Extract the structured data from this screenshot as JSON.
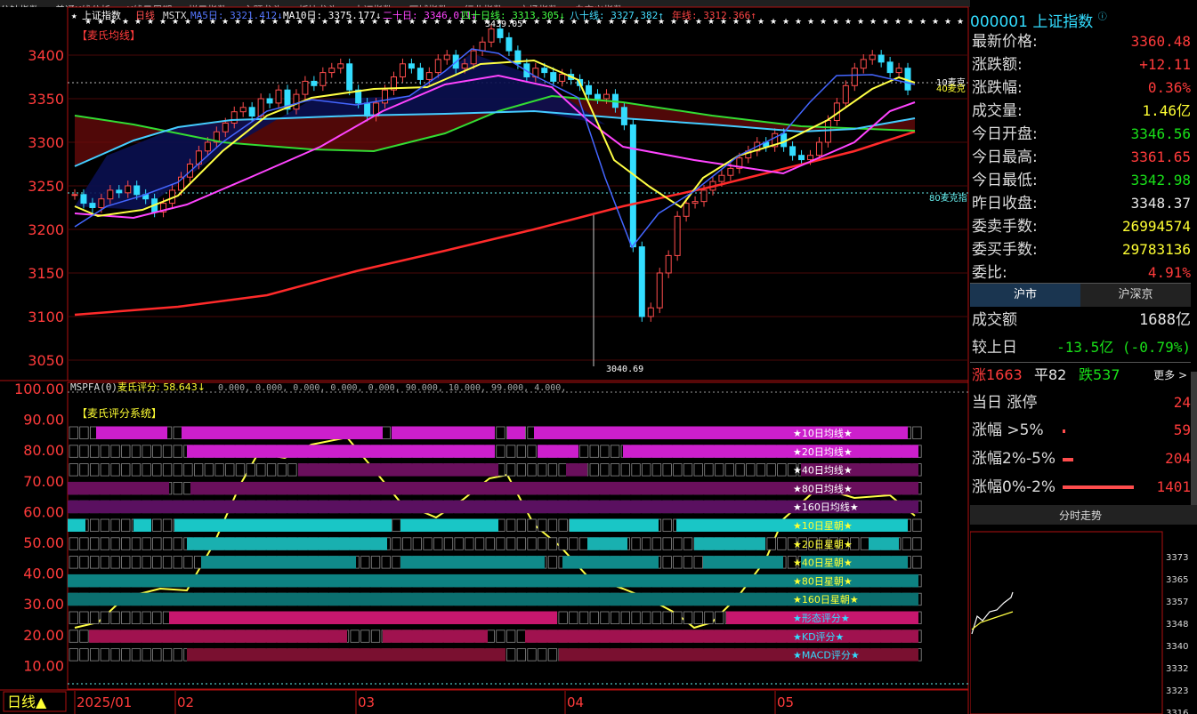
{
  "topbar": {
    "items": [
      "分钟指数",
      "普通K线分析",
      "K线日周期",
      "栏目指数",
      "主题龙头",
      "板块龙头",
      "中证指数",
      "区域指数",
      "行业指数",
      "市场指数",
      "自定义指数"
    ]
  },
  "main_legend": {
    "star": "★",
    "index_name": "上证指数",
    "period": "日线",
    "indicator_name": "MSTX",
    "ma5": "MA5日: 3321.412↓",
    "ma10": "MA10日: 3375.177↓",
    "ma20": "二十日: 3346.011↓",
    "ma40": "四十日线: 3313.305↓",
    "ma80": "八十线: 3327.382↑",
    "ma_long": "年线: 3312.366↑"
  },
  "labels": {
    "main_title": "【麦氏均线】",
    "high_marker": "3439.05",
    "low_marker": "3040.69",
    "right_10": "10麦克",
    "right_40": "40麦克",
    "right_80": "80麦克指",
    "sub_legend": "MSPFA(0)",
    "score_label": "麦氏评分: 58.643↓",
    "score_params": "0.000,  0.000,  0.000,  0.000,  0.000,  90.000,  10.000,  99.000,  4.000,",
    "score_title": "【麦氏评分系统】",
    "period_button": "日线▲",
    "date_labels": [
      "2025/01",
      "02",
      "03",
      "04",
      "05"
    ]
  },
  "price_axis": {
    "ticks": [
      3400,
      3350,
      3300,
      3250,
      3200,
      3150,
      3100,
      3050
    ]
  },
  "score_axis": {
    "ticks": [
      "100.00",
      "90.00",
      "80.00",
      "70.00",
      "60.00",
      "50.00",
      "40.00",
      "30.00",
      "20.00",
      "10.00"
    ]
  },
  "score_rows": [
    {
      "label": "★10日均线★"
    },
    {
      "label": "★20日均线★"
    },
    {
      "label": "★40日均线★"
    },
    {
      "label": "★80日均线★"
    },
    {
      "label": "★160日均线★"
    },
    {
      "label": "★10日星朝★"
    },
    {
      "label": "★20日星朝★"
    },
    {
      "label": "★40日星朝★"
    },
    {
      "label": "★80日星朝★"
    },
    {
      "label": "★160日星朝★"
    },
    {
      "label": "★形态评分★"
    },
    {
      "label": "★KD评分★"
    },
    {
      "label": "★MACD评分★"
    }
  ],
  "colors": {
    "magenta": "#cc1fcc",
    "dark_purple": "#6a0f5c",
    "cyan": "#19c6c6",
    "dark_teal": "#0d8282",
    "pink": "#c8176e",
    "maroon": "#7a1030",
    "up_red": "#ff3b3b",
    "down_cyan": "#33ddff"
  },
  "side": {
    "code": "000001",
    "name": "上证指数",
    "rows": [
      {
        "k": "最新价格:",
        "v": "3360.48",
        "c": "red"
      },
      {
        "k": "涨跌额:",
        "v": "+12.11",
        "c": "red"
      },
      {
        "k": "涨跌幅:",
        "v": "0.36%",
        "c": "red"
      },
      {
        "k": "成交量:",
        "v": "1.46亿",
        "c": "yellow"
      },
      {
        "k": "今日开盘:",
        "v": "3346.56",
        "c": "green"
      },
      {
        "k": "今日最高:",
        "v": "3361.65",
        "c": "red"
      },
      {
        "k": "今日最低:",
        "v": "3342.98",
        "c": "green"
      },
      {
        "k": "昨日收盘:",
        "v": "3348.37",
        "c": "white"
      },
      {
        "k": "委卖手数:",
        "v": "26994574",
        "c": "yellow"
      },
      {
        "k": "委买手数:",
        "v": "29783136",
        "c": "yellow"
      },
      {
        "k": "委比:",
        "v": "4.91%",
        "c": "red"
      }
    ],
    "tab_hushi": "沪市",
    "tab_hushenjing": "沪深京",
    "turnover_label": "成交额",
    "turnover_value": "1688亿",
    "compare_label": "较上日",
    "compare_value": "-13.5亿 (-0.79%)",
    "rise_label": "涨1663",
    "flat_label": "平82",
    "fall_label": "跌537",
    "more_label": "更多 >",
    "limit_label": "当日 涨停",
    "limit_value": "24",
    "gt5_label": "涨幅 >5%",
    "gt5_value": "59",
    "r2to5_label": "涨幅2%-5%",
    "r2to5_value": "204",
    "r0to2_label": "涨幅0%-2%",
    "r0to2_value": "1401",
    "intraday_title": "分时走势",
    "intraday_ticks": [
      "3373",
      "3365",
      "3357",
      "3348",
      "3340",
      "3332",
      "3323",
      "3316"
    ]
  }
}
